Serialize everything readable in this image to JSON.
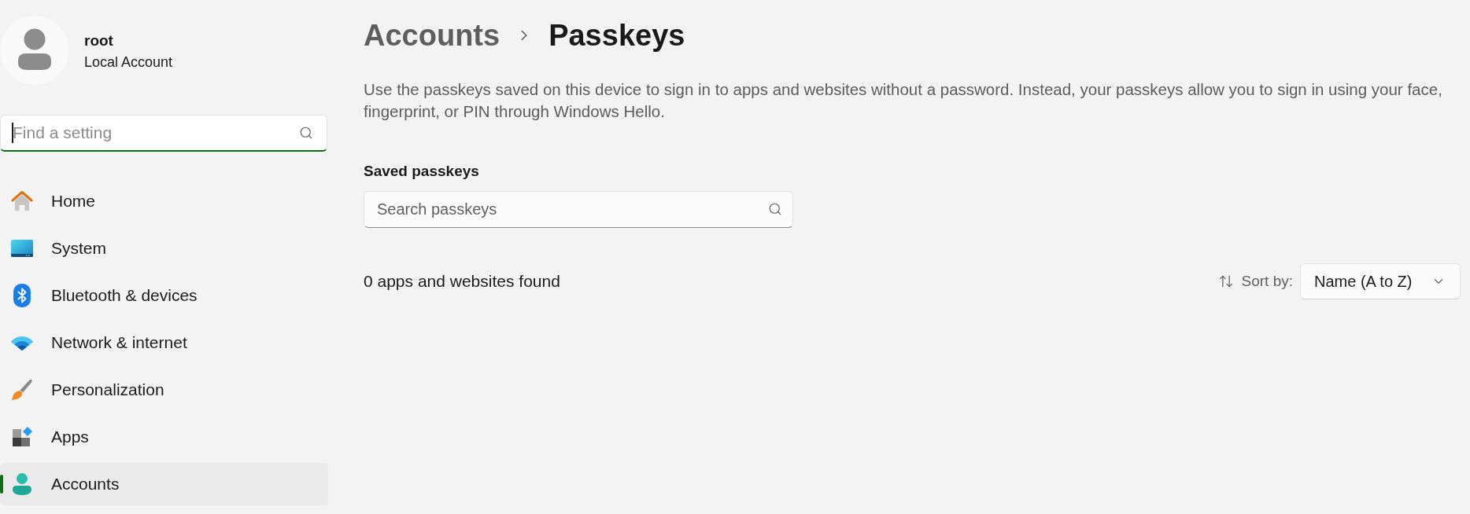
{
  "account": {
    "name": "root",
    "type": "Local Account"
  },
  "search": {
    "placeholder": "Find a setting",
    "focused": true
  },
  "nav": {
    "items": [
      {
        "label": "Home",
        "selected": false
      },
      {
        "label": "System",
        "selected": false
      },
      {
        "label": "Bluetooth & devices",
        "selected": false
      },
      {
        "label": "Network & internet",
        "selected": false
      },
      {
        "label": "Personalization",
        "selected": false
      },
      {
        "label": "Apps",
        "selected": false
      },
      {
        "label": "Accounts",
        "selected": true
      }
    ]
  },
  "breadcrumb": {
    "parent": "Accounts",
    "current": "Passkeys"
  },
  "description": "Use the passkeys saved on this device to sign in to apps and websites without a password. Instead, your passkeys allow you to sign in using your face, fingerprint, or PIN through Windows Hello.",
  "saved_passkeys": {
    "heading": "Saved passkeys",
    "search": {
      "placeholder": "Search passkeys"
    },
    "count": "0 apps and websites found",
    "sort": {
      "label": "Sort by:",
      "value": "Name (A to Z)"
    }
  }
}
